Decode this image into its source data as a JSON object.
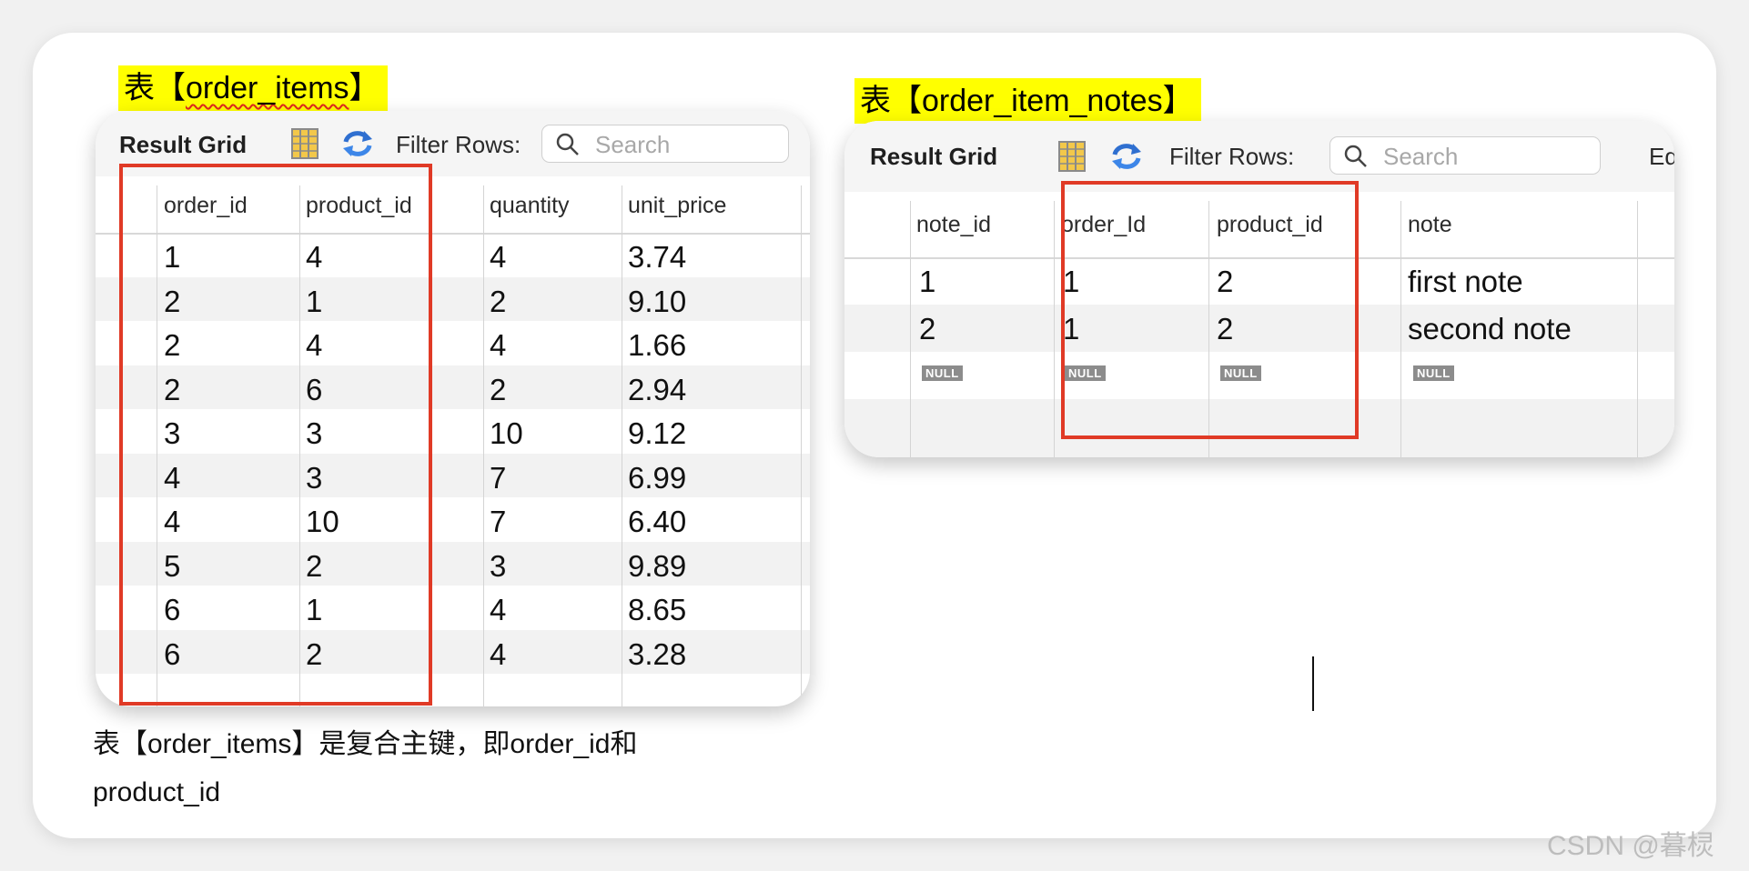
{
  "left_label": {
    "prefix": "表【",
    "name": "order_items",
    "suffix": "】"
  },
  "right_label": "表【order_item_notes】",
  "left_toolbar": {
    "title": "Result Grid",
    "filter_label": "Filter Rows:",
    "search_placeholder": "Search"
  },
  "right_toolbar": {
    "title": "Result Grid",
    "filter_label": "Filter Rows:",
    "search_placeholder": "Search",
    "extra": "Ed"
  },
  "left_table": {
    "columns": [
      "order_id",
      "product_id",
      "quantity",
      "unit_price"
    ],
    "rows": [
      [
        "1",
        "4",
        "4",
        "3.74"
      ],
      [
        "2",
        "1",
        "2",
        "9.10"
      ],
      [
        "2",
        "4",
        "4",
        "1.66"
      ],
      [
        "2",
        "6",
        "2",
        "2.94"
      ],
      [
        "3",
        "3",
        "10",
        "9.12"
      ],
      [
        "4",
        "3",
        "7",
        "6.99"
      ],
      [
        "4",
        "10",
        "7",
        "6.40"
      ],
      [
        "5",
        "2",
        "3",
        "9.89"
      ],
      [
        "6",
        "1",
        "4",
        "8.65"
      ],
      [
        "6",
        "2",
        "4",
        "3.28"
      ]
    ]
  },
  "right_table": {
    "columns": [
      "note_id",
      "order_Id",
      "product_id",
      "note"
    ],
    "rows": [
      [
        "1",
        "1",
        "2",
        "first note"
      ],
      [
        "2",
        "1",
        "2",
        "second note"
      ]
    ],
    "null_label": "NULL"
  },
  "caption": {
    "line1": "表【order_items】是复合主键，即order_id和",
    "line2": "product_id"
  },
  "watermark": "CSDN @暮棂",
  "colors": {
    "highlight": "#ffff00",
    "red_box": "#e03a26"
  },
  "icons": [
    "grid-columns-icon",
    "refresh-icon",
    "search-icon"
  ]
}
